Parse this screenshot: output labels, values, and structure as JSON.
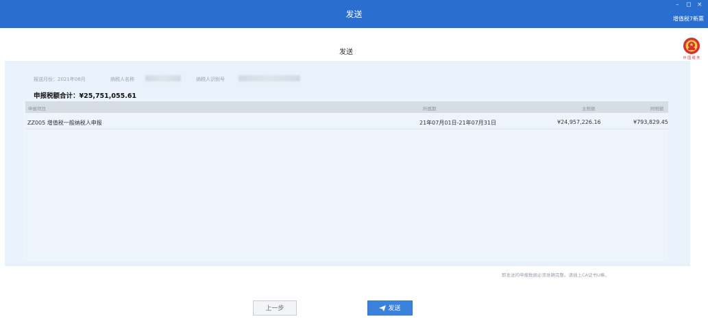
{
  "window": {
    "title": "发送",
    "right_label": "增值税7新票",
    "controls": [
      "–",
      "◻",
      "×"
    ]
  },
  "page": {
    "title": "发送"
  },
  "emblem": {
    "caption": "中 国 税 务"
  },
  "info": {
    "period_label": "报送月份：2021年08月",
    "taxpayer_name_label": "纳税人名称",
    "taxpayer_id_label": "纳税人识别号",
    "total_label": "申报税额合计：¥25,751,055.61"
  },
  "table": {
    "columns": [
      "申报项目",
      "所属期",
      "主税额",
      "附税额"
    ],
    "rows": [
      {
        "item": "ZZ005 增值税一般纳税人申报",
        "period": "21年07月01日-21年07月31日",
        "main_tax": "¥24,957,226.16",
        "surtax": "¥793,829.45"
      }
    ]
  },
  "notice": "即发送的申报数据必须准确完整。请插上CA证书U棒。",
  "buttons": {
    "prev_label": "上一步",
    "send_label": "发送"
  },
  "colors": {
    "titlebar": "#2a6fd0",
    "panel": "#e9f1fb",
    "send_button": "#3b82dc"
  }
}
